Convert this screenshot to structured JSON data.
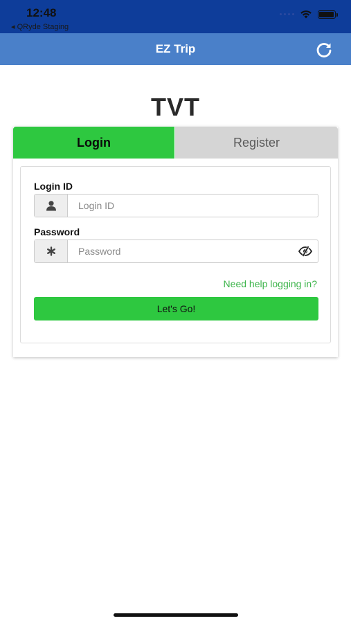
{
  "status_bar": {
    "time": "12:48",
    "back_app": "◂ QRyde Staging",
    "icons": [
      "signal-icon",
      "wifi-icon",
      "battery-icon"
    ]
  },
  "nav_bar": {
    "title": "EZ Trip",
    "refresh_icon": "refresh-icon"
  },
  "brand": {
    "title": "TVT"
  },
  "tabs": [
    {
      "label": "Login",
      "active": true
    },
    {
      "label": "Register",
      "active": false
    }
  ],
  "login_form": {
    "login_id": {
      "label": "Login ID",
      "placeholder": "Login ID",
      "value": "",
      "icon": "user-icon"
    },
    "password": {
      "label": "Password",
      "placeholder": "Password",
      "value": "",
      "icon": "asterisk-icon",
      "toggle_icon": "eye-slash-icon"
    },
    "help_link": "Need help logging in?",
    "submit_label": "Let's Go!"
  },
  "colors": {
    "status_bar_bg": "#0e3d9a",
    "nav_bar_bg": "#4a80c9",
    "accent_green": "#2ec840",
    "link_green": "#3cb44a",
    "inactive_tab": "#d5d5d5"
  }
}
